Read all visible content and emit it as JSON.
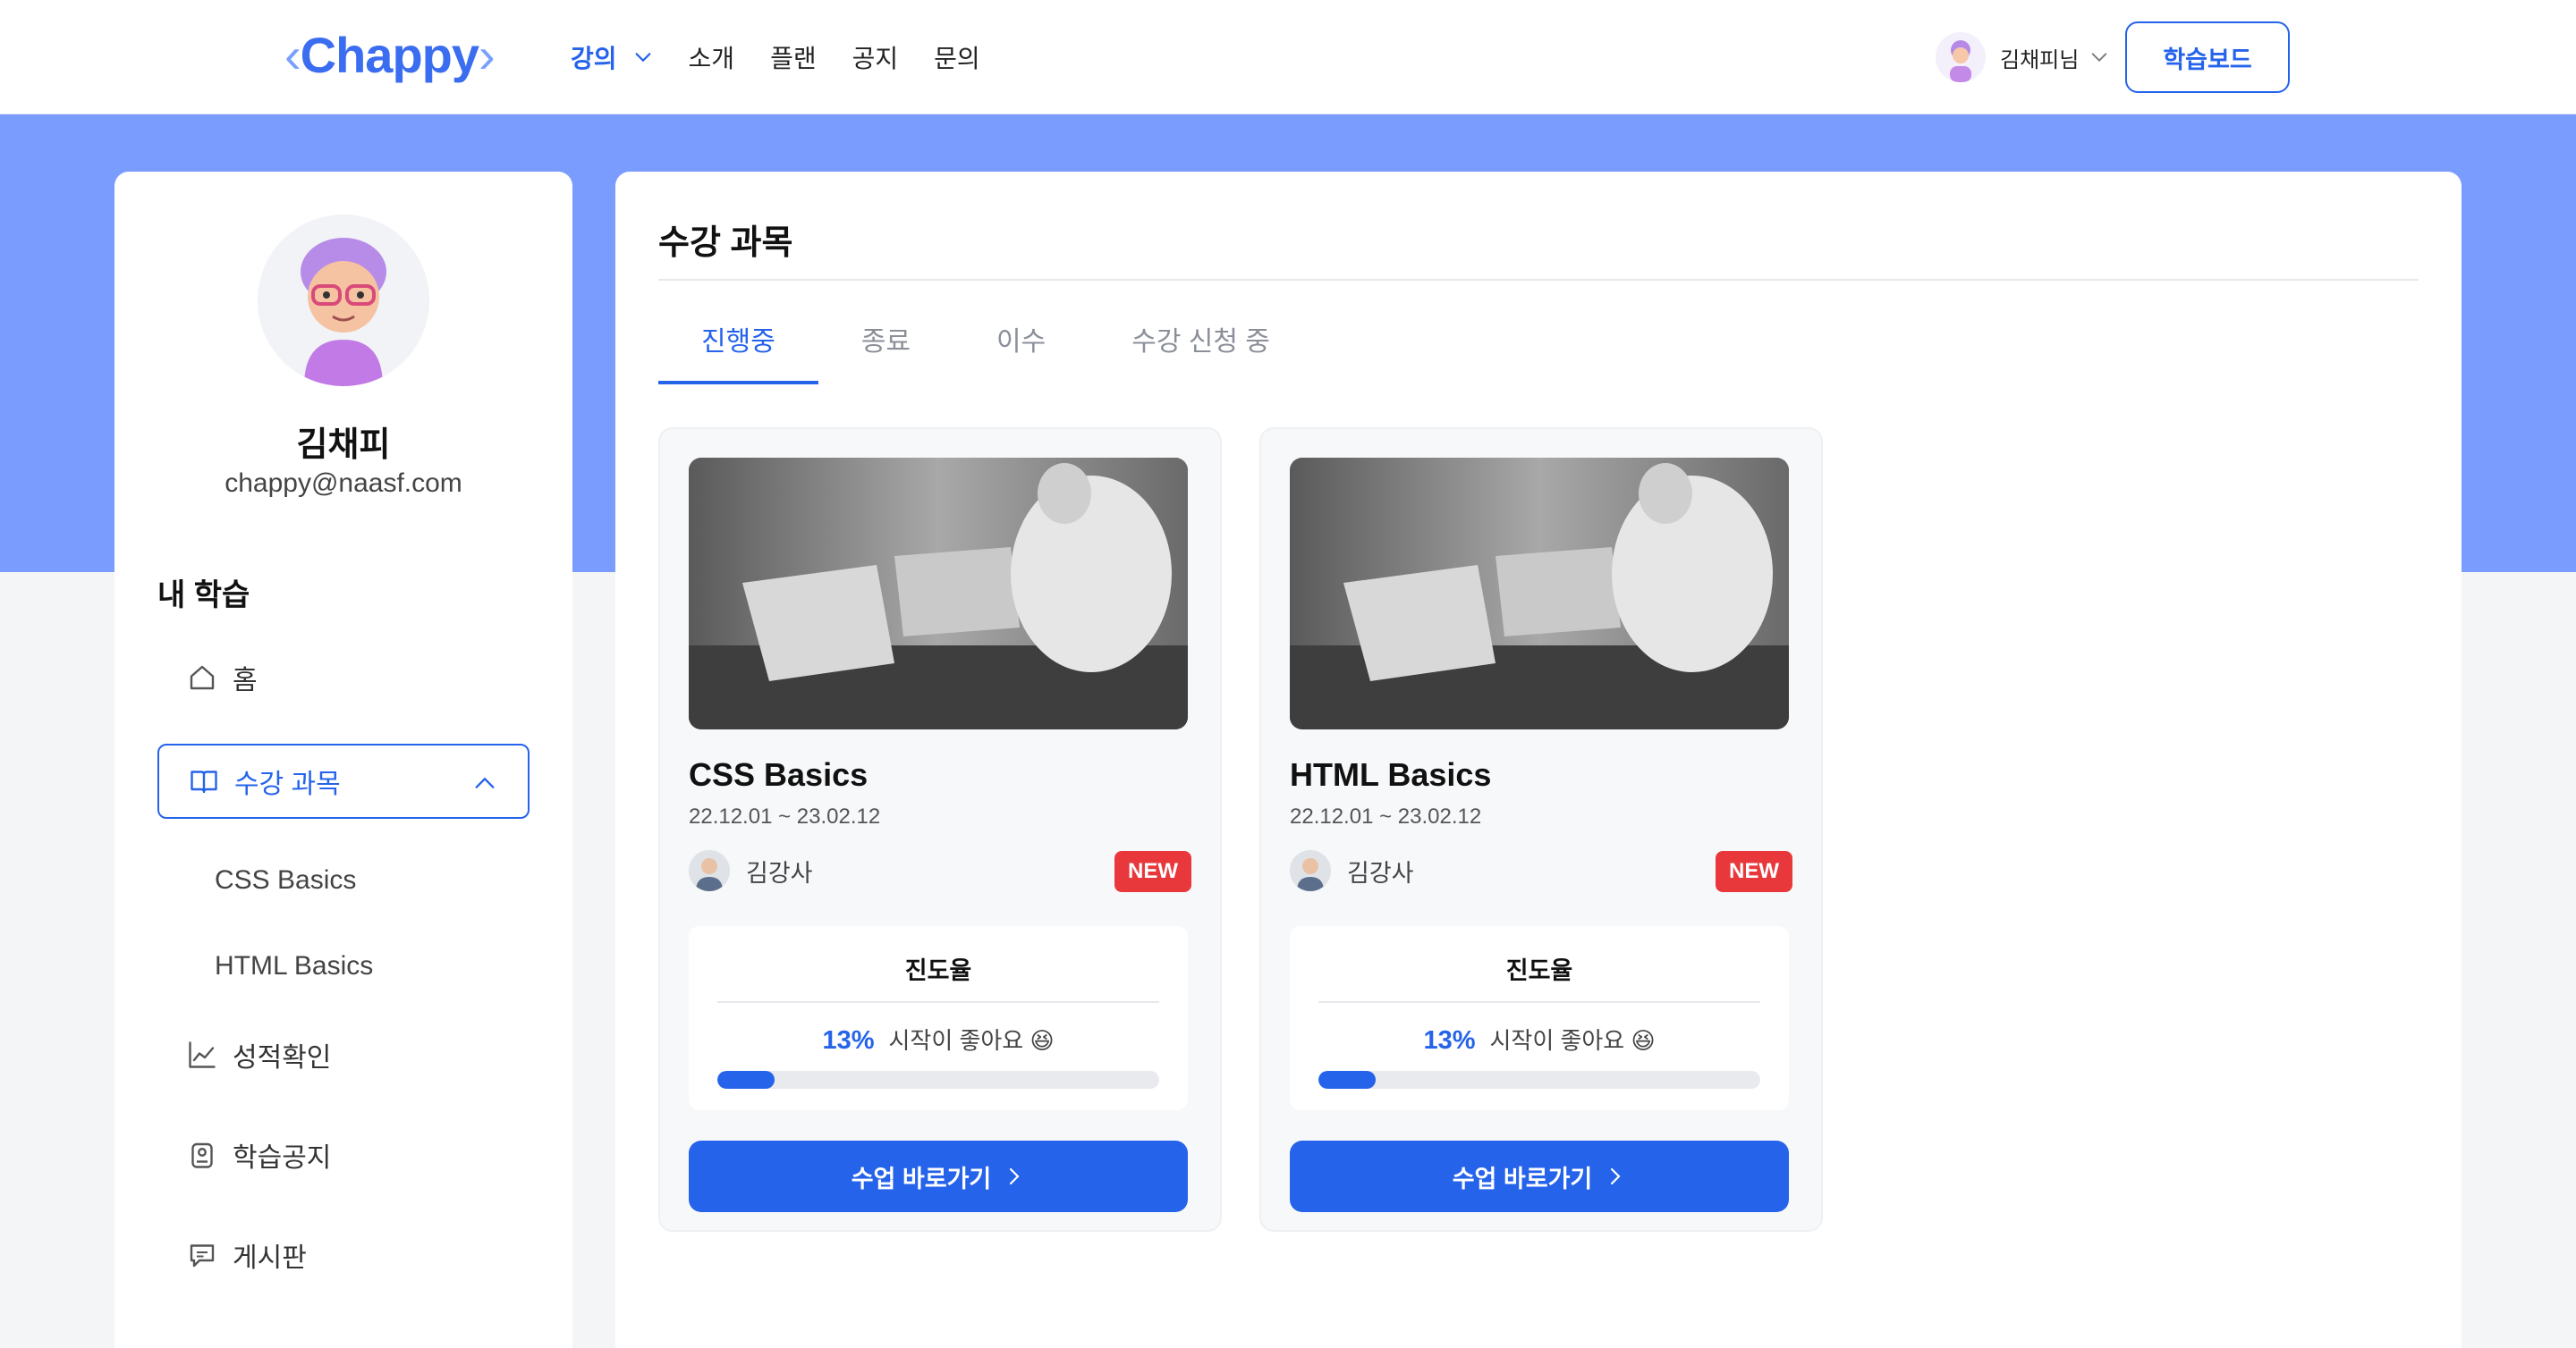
{
  "header": {
    "logo": "Chappy",
    "nav": [
      {
        "label": "강의",
        "active": true
      },
      {
        "label": "소개"
      },
      {
        "label": "플랜"
      },
      {
        "label": "공지"
      },
      {
        "label": "문의"
      }
    ],
    "user_name": "김채피님",
    "dashboard_label": "학습보드",
    "accent": "#2563eb",
    "banner_color": "#7b9cff"
  },
  "sidebar": {
    "name": "김채피",
    "email": "chappy@naasf.com",
    "section_title": "내 학습",
    "home": "홈",
    "courses": "수강 과목",
    "sub_items": [
      "CSS Basics",
      "HTML Basics"
    ],
    "grades": "성적확인",
    "notices": "학습공지",
    "board": "게시판"
  },
  "main": {
    "title": "수강 과목",
    "tabs": [
      "진행중",
      "종료",
      "이수",
      "수강 신청 중"
    ],
    "active_tab": "진행중",
    "courses": [
      {
        "title": "CSS Basics",
        "dates": "22.12.01 ~ 23.02.12",
        "teacher": "김강사",
        "badge": "NEW",
        "progress_label": "진도율",
        "progress_pct": "13%",
        "progress_value": 13,
        "progress_msg": "시작이 좋아요 😆",
        "button": "수업 바로가기"
      },
      {
        "title": "HTML Basics",
        "dates": "22.12.01 ~ 23.02.12",
        "teacher": "김강사",
        "badge": "NEW",
        "progress_label": "진도율",
        "progress_pct": "13%",
        "progress_value": 13,
        "progress_msg": "시작이 좋아요 😆",
        "button": "수업 바로가기"
      }
    ]
  }
}
